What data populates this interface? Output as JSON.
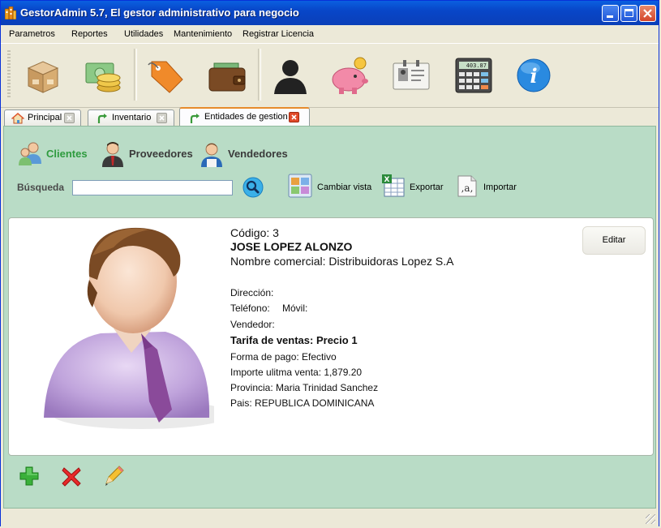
{
  "window": {
    "title": "GestorAdmin 5.7,  El gestor administrativo para negocio"
  },
  "menu": [
    "Parametros",
    "Reportes",
    "Utilidades",
    "Mantenimiento",
    "Registrar Licencia"
  ],
  "toolbar": {
    "icons": [
      "box-icon",
      "money-icon",
      "price-tag-icon",
      "wallet-icon",
      "person-silhouette-icon",
      "piggy-bank-icon",
      "contact-card-icon",
      "calculator-icon",
      "info-icon"
    ]
  },
  "tabs": [
    {
      "label": "Principal",
      "icon": "home-icon",
      "active": false
    },
    {
      "label": "Inventario",
      "icon": "arrow-icon",
      "active": false
    },
    {
      "label": "Entidades de gestion",
      "icon": "arrow-icon",
      "active": true
    }
  ],
  "categories": [
    {
      "label": "Clientes",
      "color": "#2e9b3e"
    },
    {
      "label": "Proveedores",
      "color": "#3a3a3a"
    },
    {
      "label": "Vendedores",
      "color": "#3a3a3a"
    }
  ],
  "search": {
    "label": "Búsqueda",
    "value": ""
  },
  "actions": {
    "change_view": "Cambiar vista",
    "export": "Exportar",
    "import": "Importar"
  },
  "record": {
    "code": "Código: 3",
    "name": "JOSE LOPEZ ALONZO",
    "trade_name": "Nombre comercial: Distribuidoras Lopez S.A",
    "address": "Dirección:",
    "phone": "Teléfono:",
    "mobile": "Móvil:",
    "seller": "Vendedor:",
    "rate": "Tarifa de ventas: Precio 1",
    "payment": "Forma de pago: Efectivo",
    "last_sale": "Importe ulitma venta: 1,879.20",
    "province": "Provincia: Maria Trinidad Sanchez",
    "country": "Pais: REPUBLICA DOMINICANA"
  },
  "edit_label": "Editar",
  "calculator_display": "403.87",
  "colors": {
    "panel_bg": "#b9dcc6",
    "active_category": "#2e9b3e",
    "titlebar": "#0a5fe0"
  }
}
